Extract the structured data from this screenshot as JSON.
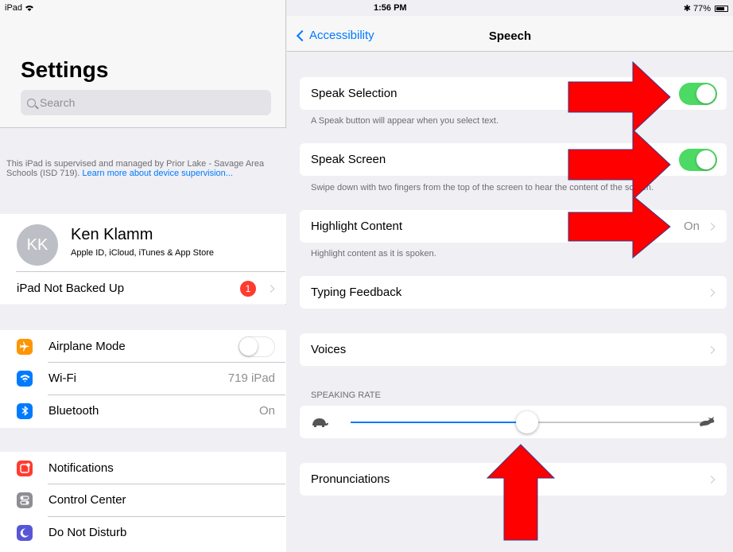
{
  "status_bar": {
    "device": "iPad",
    "time": "1:56 PM",
    "battery_percent": "77%",
    "battery_level": 0.77
  },
  "left": {
    "title": "Settings",
    "search_placeholder": "Search",
    "supervised_text": "This iPad is supervised and managed by Prior Lake - Savage Area Schools (ISD 719).",
    "supervised_link": "Learn more about device supervision...",
    "profile": {
      "initials": "KK",
      "name": "Ken Klamm",
      "subtitle": "Apple ID, iCloud, iTunes & App Store"
    },
    "backup": {
      "label": "iPad Not Backed Up",
      "badge": "1"
    },
    "connectivity": [
      {
        "label": "Airplane Mode",
        "icon": "airplane-icon",
        "color": "#ff9500"
      },
      {
        "label": "Wi-Fi",
        "value": "719 iPad",
        "icon": "wifi-icon",
        "color": "#007aff"
      },
      {
        "label": "Bluetooth",
        "value": "On",
        "icon": "bluetooth-icon",
        "color": "#007aff"
      }
    ],
    "system": [
      {
        "label": "Notifications",
        "icon": "notifications-icon",
        "color": "#ff3b30"
      },
      {
        "label": "Control Center",
        "icon": "control-center-icon",
        "color": "#8e8e93"
      },
      {
        "label": "Do Not Disturb",
        "icon": "moon-icon",
        "color": "#5856d6"
      }
    ]
  },
  "right": {
    "back_label": "Accessibility",
    "title": "Speech",
    "speak_selection": {
      "label": "Speak Selection",
      "on": true,
      "footer": "A Speak button will appear when you select text."
    },
    "speak_screen": {
      "label": "Speak Screen",
      "on": true,
      "footer": "Swipe down with two fingers from the top of the screen to hear the content of the screen."
    },
    "highlight_content": {
      "label": "Highlight Content",
      "value": "On",
      "footer": "Highlight content as it is spoken."
    },
    "typing_feedback": {
      "label": "Typing Feedback"
    },
    "voices": {
      "label": "Voices"
    },
    "speaking_rate": {
      "header": "SPEAKING RATE",
      "value": 0.5
    },
    "pronunciations": {
      "label": "Pronunciations"
    }
  },
  "colors": {
    "accent": "#007aff",
    "toggle_on": "#4cd964",
    "annotation_arrow": "#ff0000",
    "badge": "#ff3b30"
  }
}
